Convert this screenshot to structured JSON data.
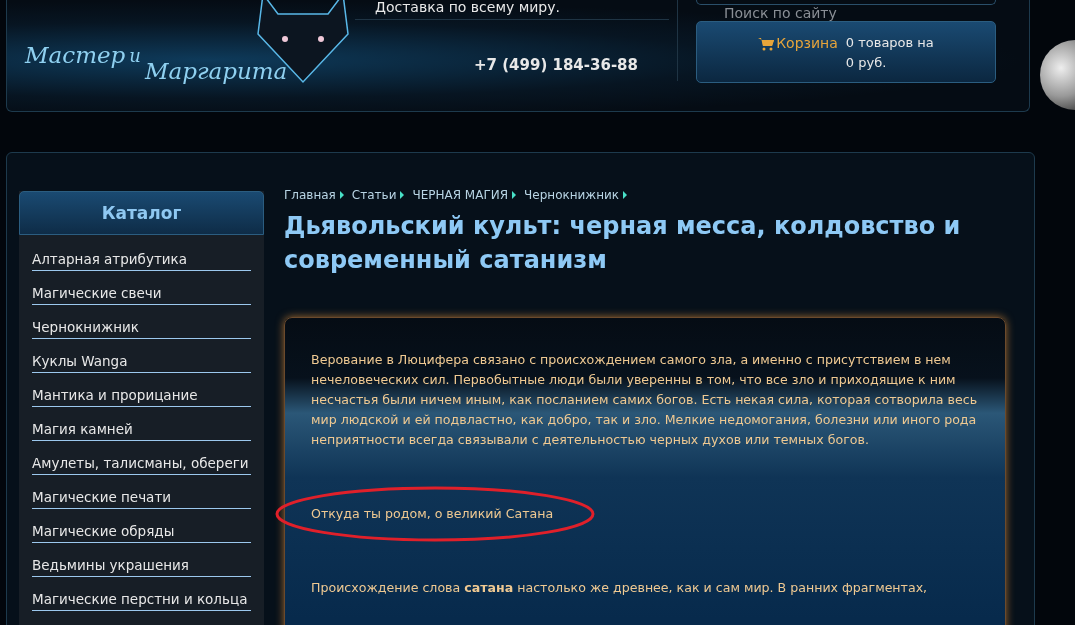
{
  "header": {
    "logo_text": [
      "Мастер",
      "и",
      "Маргарита"
    ],
    "delivery": "Доставка по всему миру.",
    "phone": "+7 (499) 184-36-88",
    "search": {
      "placeholder": "Поиск по сайту"
    },
    "cart": {
      "label": "Корзина",
      "summary": [
        "0 товаров на",
        "0 руб."
      ]
    }
  },
  "sidebar": {
    "title": "Каталог",
    "items": [
      {
        "label": "Алтарная атрибутика"
      },
      {
        "label": "Магические свечи"
      },
      {
        "label": "Чернокнижник"
      },
      {
        "label": "Куклы Wanga"
      },
      {
        "label": "Мантика и прорицание"
      },
      {
        "label": "Магия камней"
      },
      {
        "label": "Амулеты, талисманы, обереги"
      },
      {
        "label": "Магические печати"
      },
      {
        "label": "Магические обряды"
      },
      {
        "label": "Ведьмины украшения"
      },
      {
        "label": "Магические перстни и кольца"
      }
    ]
  },
  "breadcrumb": [
    "Главная",
    "Статьи",
    "ЧЕРНАЯ МАГИЯ",
    "Чернокнижник"
  ],
  "title": "Дьявольский культ: черная месса, колдовство и современный сатанизм",
  "article": [
    {
      "kind": "paragraph",
      "text": "Верование в Люцифера связано с происхождением самого зла, а именно с присутствием в нем нечеловеческих сил. Первобытные люди были уверенны в том, что все зло и приходящие к ним несчастья были ничем иным, как посланием самих богов. Есть некая сила, которая сотворила весь мир людской и ей подвластно, как добро, так и зло. Мелкие недомогания, болезни или иного рода неприятности всегда связывали с деятельностью черных духов или темных богов."
    },
    {
      "kind": "circled",
      "text": "Откуда ты родом, о великий Сатана"
    },
    {
      "kind": "paragraph",
      "text": "Происхождение слова **сатана** настолько же древнее, как и сам мир. В ранних фрагментах,"
    }
  ]
}
